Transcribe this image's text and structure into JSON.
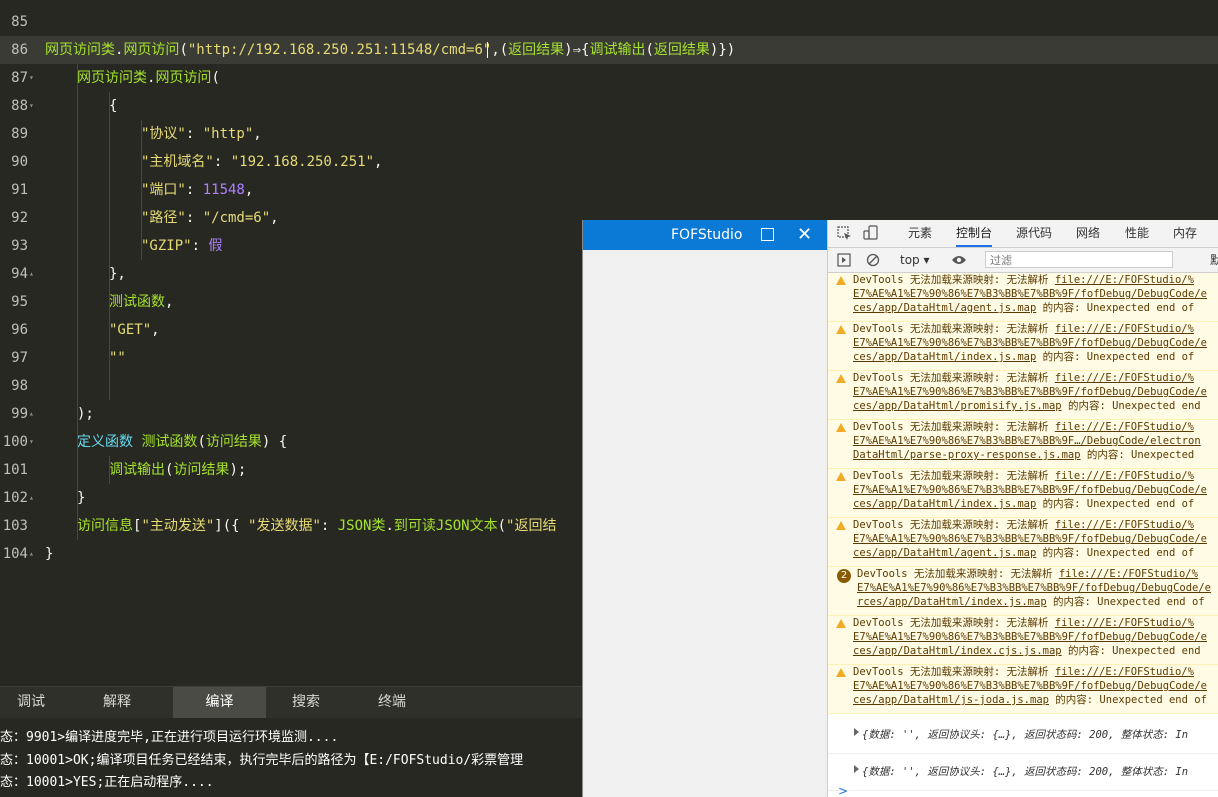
{
  "editor": {
    "lines": [
      {
        "num": "85",
        "fold": "",
        "indent": 0,
        "tokens": []
      },
      {
        "num": "86",
        "fold": "",
        "indent": 0,
        "active": true,
        "tokens": [
          [
            "fn",
            "网页访问类"
          ],
          [
            "op",
            "."
          ],
          [
            "fn",
            "网页访问"
          ],
          [
            "op",
            "("
          ],
          [
            "str",
            "\"http://192.168.250.251:11548/cmd=6\""
          ],
          [
            "op",
            ",("
          ],
          [
            "fn",
            "返回结果"
          ],
          [
            "op",
            ")⇒{"
          ],
          [
            "fn",
            "调试输出"
          ],
          [
            "op",
            "("
          ],
          [
            "fn",
            "返回结果"
          ],
          [
            "op",
            ")})"
          ]
        ]
      },
      {
        "num": "87",
        "fold": "▾",
        "indent": 1,
        "tokens": [
          [
            "fn",
            "网页访问类"
          ],
          [
            "op",
            "."
          ],
          [
            "fn",
            "网页访问"
          ],
          [
            "op",
            "("
          ]
        ]
      },
      {
        "num": "88",
        "fold": "▾",
        "indent": 2,
        "tokens": [
          [
            "op",
            "{"
          ]
        ]
      },
      {
        "num": "89",
        "fold": "",
        "indent": 3,
        "tokens": [
          [
            "str",
            "\"协议\""
          ],
          [
            "op",
            ": "
          ],
          [
            "str",
            "\"http\""
          ],
          [
            "op",
            ","
          ]
        ]
      },
      {
        "num": "90",
        "fold": "",
        "indent": 3,
        "tokens": [
          [
            "str",
            "\"主机域名\""
          ],
          [
            "op",
            ": "
          ],
          [
            "str",
            "\"192.168.250.251\""
          ],
          [
            "op",
            ","
          ]
        ]
      },
      {
        "num": "91",
        "fold": "",
        "indent": 3,
        "tokens": [
          [
            "str",
            "\"端口\""
          ],
          [
            "op",
            ": "
          ],
          [
            "num",
            "11548"
          ],
          [
            "op",
            ","
          ]
        ]
      },
      {
        "num": "92",
        "fold": "",
        "indent": 3,
        "tokens": [
          [
            "str",
            "\"路径\""
          ],
          [
            "op",
            ": "
          ],
          [
            "str",
            "\"/cmd=6\""
          ],
          [
            "op",
            ","
          ]
        ]
      },
      {
        "num": "93",
        "fold": "",
        "indent": 3,
        "tokens": [
          [
            "str",
            "\"GZIP\""
          ],
          [
            "op",
            ": "
          ],
          [
            "num",
            "假"
          ]
        ]
      },
      {
        "num": "94",
        "fold": "▴",
        "indent": 2,
        "tokens": [
          [
            "op",
            "},"
          ]
        ]
      },
      {
        "num": "95",
        "fold": "",
        "indent": 2,
        "tokens": [
          [
            "fn",
            "测试函数"
          ],
          [
            "op",
            ","
          ]
        ]
      },
      {
        "num": "96",
        "fold": "",
        "indent": 2,
        "tokens": [
          [
            "str",
            "\"GET\""
          ],
          [
            "op",
            ","
          ]
        ]
      },
      {
        "num": "97",
        "fold": "",
        "indent": 2,
        "tokens": [
          [
            "str",
            "\"\""
          ]
        ]
      },
      {
        "num": "98",
        "fold": "",
        "indent": 2,
        "tokens": []
      },
      {
        "num": "99",
        "fold": "▴",
        "indent": 1,
        "tokens": [
          [
            "op",
            ");"
          ]
        ]
      },
      {
        "num": "100",
        "fold": "▾",
        "indent": 1,
        "tokens": [
          [
            "kw",
            "定义函数"
          ],
          [
            "op",
            " "
          ],
          [
            "fn",
            "测试函数"
          ],
          [
            "op",
            "("
          ],
          [
            "fn",
            "访问结果"
          ],
          [
            "op",
            ") {"
          ]
        ]
      },
      {
        "num": "101",
        "fold": "",
        "indent": 2,
        "tokens": [
          [
            "fn",
            "调试输出"
          ],
          [
            "op",
            "("
          ],
          [
            "fn",
            "访问结果"
          ],
          [
            "op",
            ");"
          ]
        ]
      },
      {
        "num": "102",
        "fold": "▴",
        "indent": 1,
        "tokens": [
          [
            "op",
            "}"
          ]
        ]
      },
      {
        "num": "103",
        "fold": "",
        "indent": 1,
        "tokens": [
          [
            "fn",
            "访问信息"
          ],
          [
            "op",
            "["
          ],
          [
            "str",
            "\"主动发送\""
          ],
          [
            "op",
            "]({ "
          ],
          [
            "str",
            "\"发送数据\""
          ],
          [
            "op",
            ": "
          ],
          [
            "fn",
            "JSON类"
          ],
          [
            "op",
            "."
          ],
          [
            "fn",
            "到可读JSON文本"
          ],
          [
            "op",
            "("
          ],
          [
            "str",
            "\"返回结"
          ]
        ]
      },
      {
        "num": "104",
        "fold": "▴",
        "indent": 0,
        "tokens": [
          [
            "op",
            "}"
          ]
        ]
      }
    ]
  },
  "bottom_tabs": [
    "调试",
    "解释",
    "编译",
    "搜索",
    "终端"
  ],
  "bottom_active": 2,
  "output_lines": [
    "态：9901>编译进度完毕,正在进行项目运行环境监测....",
    "态：10001>OK;编译项目任务已经结束，执行完毕后的路径为【E:/FOFStudio/彩票管理",
    "态：10001>YES;正在启动程序...."
  ],
  "fof_window": {
    "title": "FOFStudio",
    "close": "✕"
  },
  "devtools": {
    "tabs": [
      "元素",
      "控制台",
      "源代码",
      "网络",
      "性能",
      "内存"
    ],
    "active_tab": 1,
    "context": "top ▾",
    "filter_placeholder": "过滤",
    "right_cut": "默",
    "messages": [
      {
        "badge": "",
        "l1": "DevTools 无法加载来源映射: 无法解析 ",
        "u1": "file:///E:/FOFStudio/%",
        "l2": "E7%AE%A1%E7%90%86%E7%B3%BB%E7%BB%9F/fofDebug/DebugCode/e",
        "l3a": "ces/app/DataHtml/agent.js.map",
        "l3b": " 的内容: Unexpected end of"
      },
      {
        "badge": "",
        "l1": "DevTools 无法加载来源映射: 无法解析 ",
        "u1": "file:///E:/FOFStudio/%",
        "l2": "E7%AE%A1%E7%90%86%E7%B3%BB%E7%BB%9F/fofDebug/DebugCode/e",
        "l3a": "ces/app/DataHtml/index.js.map",
        "l3b": " 的内容: Unexpected end of"
      },
      {
        "badge": "",
        "l1": "DevTools 无法加载来源映射: 无法解析 ",
        "u1": "file:///E:/FOFStudio/%",
        "l2": "E7%AE%A1%E7%90%86%E7%B3%BB%E7%BB%9F/fofDebug/DebugCode/e",
        "l3a": "ces/app/DataHtml/promisify.js.map",
        "l3b": " 的内容: Unexpected end"
      },
      {
        "badge": "",
        "l1": "DevTools 无法加载来源映射: 无法解析 ",
        "u1": "file:///E:/FOFStudio/%",
        "l2": "E7%AE%A1%E7%90%86%E7%B3%BB%E7%BB%9F…/DebugCode/electron",
        "l3a": "DataHtml/parse-proxy-response.js.map",
        "l3b": " 的内容: Unexpected"
      },
      {
        "badge": "",
        "l1": "DevTools 无法加载来源映射: 无法解析 ",
        "u1": "file:///E:/FOFStudio/%",
        "l2": "E7%AE%A1%E7%90%86%E7%B3%BB%E7%BB%9F/fofDebug/DebugCode/e",
        "l3a": "ces/app/DataHtml/index.js.map",
        "l3b": " 的内容: Unexpected end of"
      },
      {
        "badge": "",
        "l1": "DevTools 无法加载来源映射: 无法解析 ",
        "u1": "file:///E:/FOFStudio/%",
        "l2": "E7%AE%A1%E7%90%86%E7%B3%BB%E7%BB%9F/fofDebug/DebugCode/e",
        "l3a": "ces/app/DataHtml/agent.js.map",
        "l3b": " 的内容: Unexpected end of"
      },
      {
        "badge": "2",
        "l1": "DevTools 无法加载来源映射: 无法解析 ",
        "u1": "file:///E:/FOFStudio/%",
        "l2": "E7%AE%A1%E7%90%86%E7%B3%BB%E7%BB%9F/fofDebug/DebugCode/e",
        "l3a": "rces/app/DataHtml/index.js.map",
        "l3b": " 的内容: Unexpected end of"
      },
      {
        "badge": "",
        "l1": "DevTools 无法加载来源映射: 无法解析 ",
        "u1": "file:///E:/FOFStudio/%",
        "l2": "E7%AE%A1%E7%90%86%E7%B3%BB%E7%BB%9F/fofDebug/DebugCode/e",
        "l3a": "ces/app/DataHtml/index.cjs.js.map",
        "l3b": " 的内容: Unexpected end"
      },
      {
        "badge": "",
        "l1": "DevTools 无法加载来源映射: 无法解析 ",
        "u1": "file:///E:/FOFStudio/%",
        "l2": "E7%AE%A1%E7%90%86%E7%B3%BB%E7%BB%9F/fofDebug/DebugCode/e",
        "l3a": "ces/app/DataHtml/js-joda.js.map",
        "l3b": " 的内容: Unexpected end of"
      }
    ],
    "logs": [
      "{数据: '', 返回协议头: {…}, 返回状态码: 200, 整体状态: In",
      "{数据: '', 返回协议头: {…}, 返回状态码: 200, 整体状态: In"
    ],
    "prompt": ">"
  },
  "colors": {
    "editor_bg": "#272822",
    "string": "#e6db74",
    "function": "#a6e22e",
    "keyword": "#66d9ef",
    "number": "#ae81ff",
    "titlebar": "#0a7ad6"
  }
}
